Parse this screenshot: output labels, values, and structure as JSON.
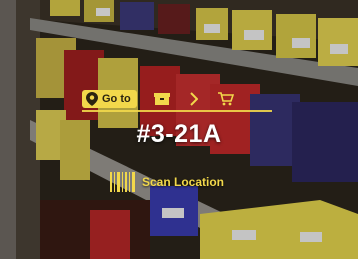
{
  "navigation": {
    "goto_label": "Go to",
    "goto_icon": "location-pin-icon",
    "steps": [
      {
        "name": "box-icon"
      },
      {
        "name": "chevron-right-icon"
      },
      {
        "name": "cart-icon"
      }
    ]
  },
  "location": {
    "code": "#3-21A"
  },
  "scan": {
    "label": "Scan Location",
    "icon": "barcode-icon"
  },
  "colors": {
    "accent": "#f2d84b",
    "text": "#ffffff"
  }
}
